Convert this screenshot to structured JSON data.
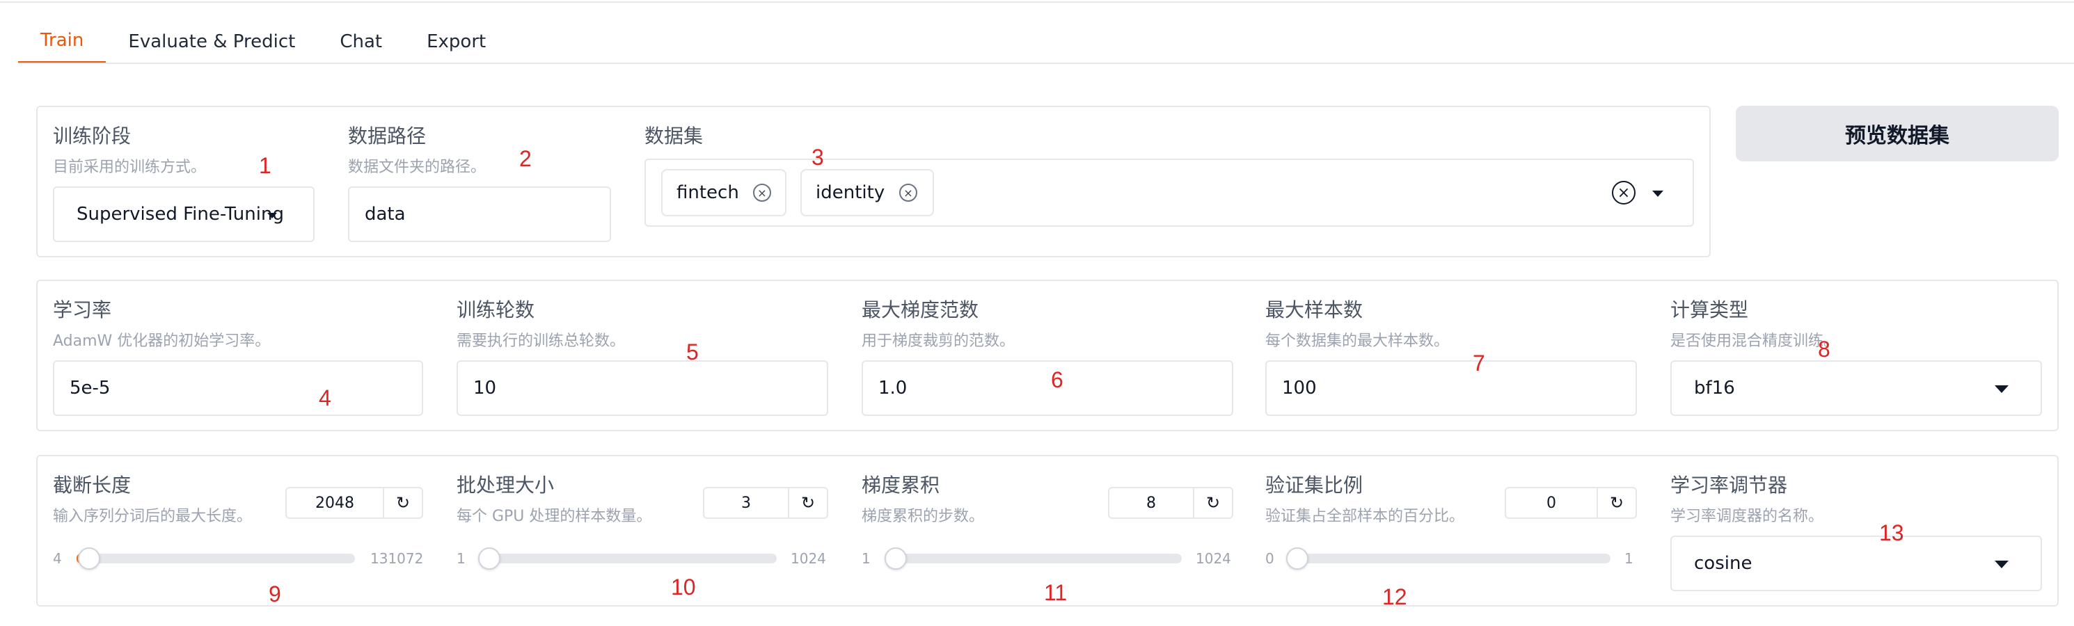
{
  "tabs": [
    {
      "label": "Train",
      "active": true
    },
    {
      "label": "Evaluate & Predict",
      "active": false
    },
    {
      "label": "Chat",
      "active": false
    },
    {
      "label": "Export",
      "active": false
    }
  ],
  "row1": {
    "training_stage": {
      "label": "训练阶段",
      "info": "目前采用的训练方式。",
      "value": "Supervised Fine-Tuning"
    },
    "data_path": {
      "label": "数据路径",
      "info": "数据文件夹的路径。",
      "value": "data"
    },
    "dataset": {
      "label": "数据集",
      "chips": [
        "fintech",
        "identity"
      ]
    },
    "preview_button": "预览数据集"
  },
  "row2": {
    "learning_rate": {
      "label": "学习率",
      "info": "AdamW 优化器的初始学习率。",
      "value": "5e-5"
    },
    "epochs": {
      "label": "训练轮数",
      "info": "需要执行的训练总轮数。",
      "value": "10"
    },
    "max_grad_norm": {
      "label": "最大梯度范数",
      "info": "用于梯度裁剪的范数。",
      "value": "1.0"
    },
    "max_samples": {
      "label": "最大样本数",
      "info": "每个数据集的最大样本数。",
      "value": "100"
    },
    "compute_type": {
      "label": "计算类型",
      "info": "是否使用混合精度训练。",
      "value": "bf16"
    }
  },
  "row3": {
    "cutoff_len": {
      "label": "截断长度",
      "info": "输入序列分词后的最大长度。",
      "value": "2048",
      "min": "4",
      "max": "131072",
      "fraction": 0.0156
    },
    "batch_size": {
      "label": "批处理大小",
      "info": "每个 GPU 处理的样本数量。",
      "value": "3",
      "min": "1",
      "max": "1024",
      "fraction": 0.002
    },
    "grad_accum": {
      "label": "梯度累积",
      "info": "梯度累积的步数。",
      "value": "8",
      "min": "1",
      "max": "1024",
      "fraction": 0.007
    },
    "val_size": {
      "label": "验证集比例",
      "info": "验证集占全部样本的百分比。",
      "value": "0",
      "min": "0",
      "max": "1",
      "fraction": 0
    },
    "lr_scheduler": {
      "label": "学习率调节器",
      "info": "学习率调度器的名称。",
      "value": "cosine"
    }
  },
  "icons": {
    "reset": "↻",
    "close": "×"
  },
  "annotations": [
    "1",
    "2",
    "3",
    "4",
    "5",
    "6",
    "7",
    "8",
    "9",
    "10",
    "11",
    "12",
    "13"
  ],
  "colors": {
    "accent": "#ea580c",
    "annotation": "#dc2626",
    "border": "#e5e7eb"
  }
}
